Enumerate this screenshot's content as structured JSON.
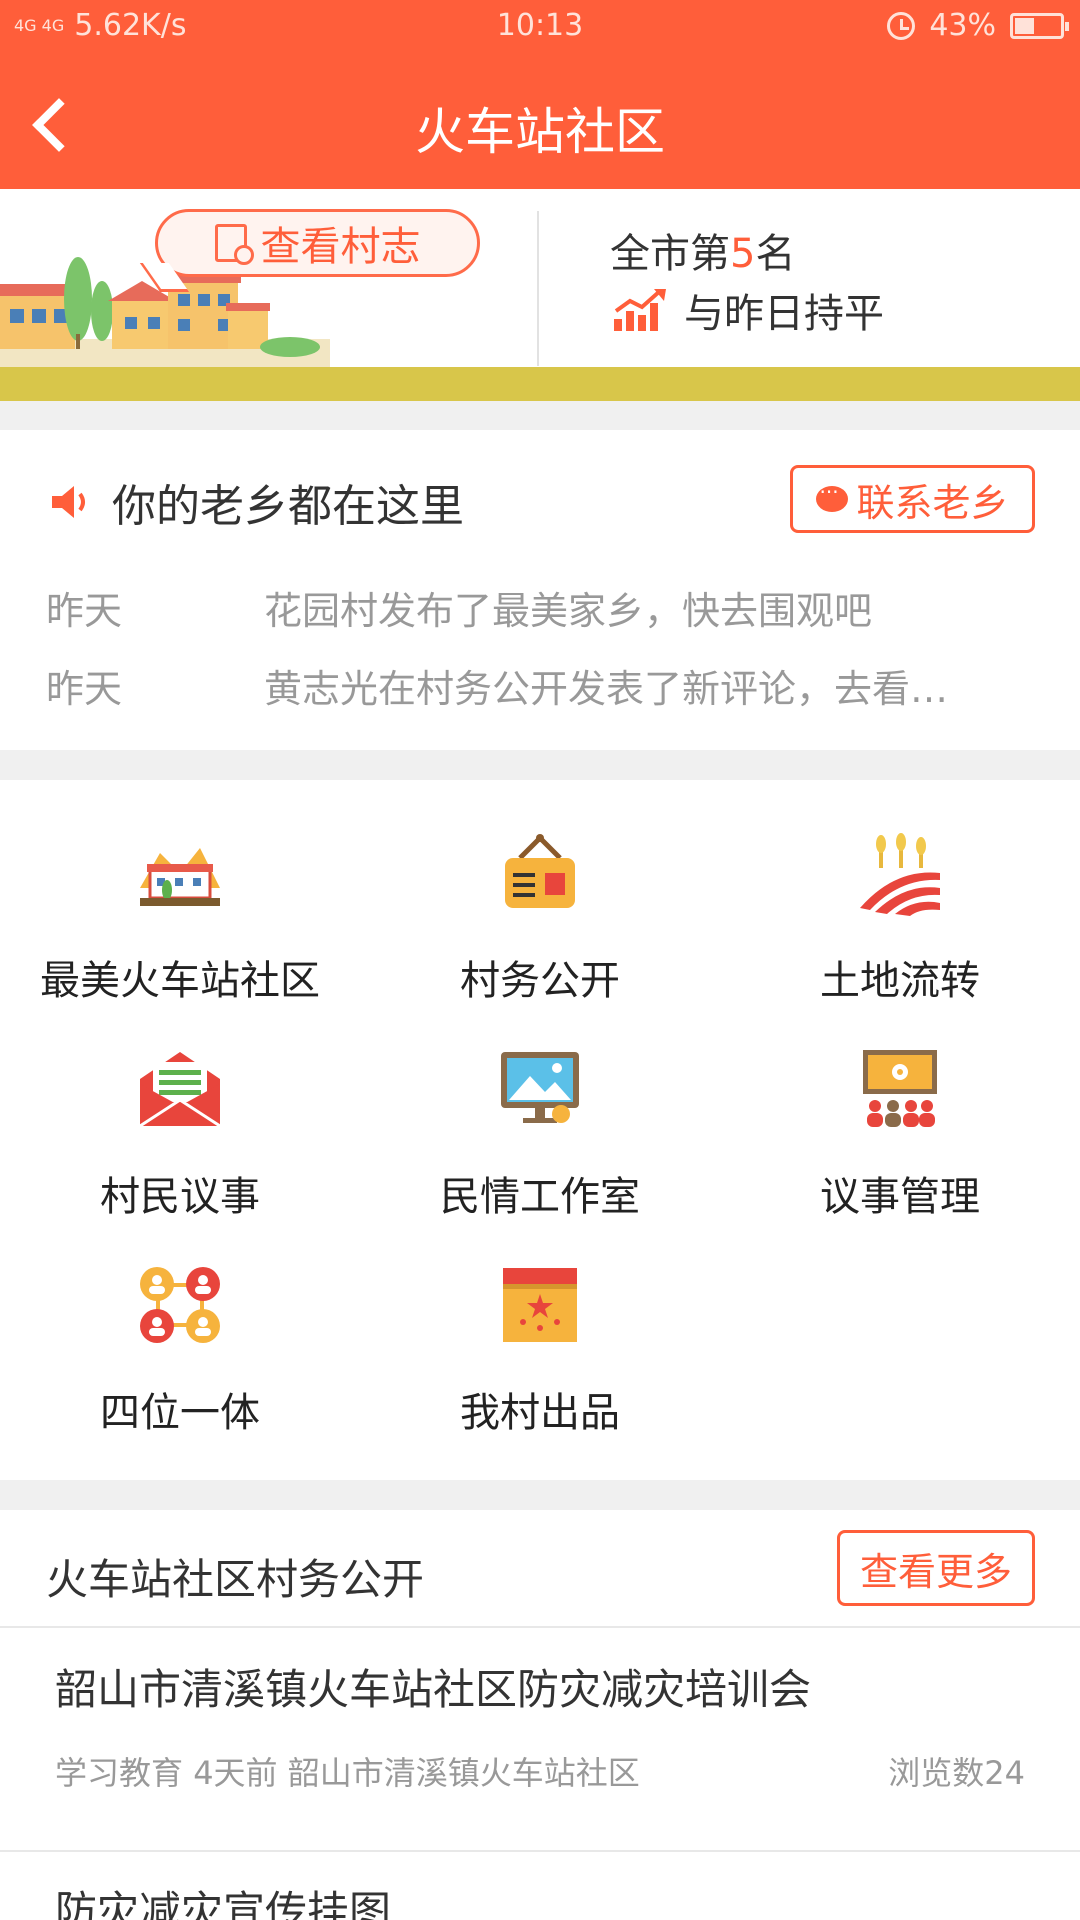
{
  "status": {
    "network": "4G 4G",
    "speed": "5.62K/s",
    "time": "10:13",
    "battery": "43%",
    "battery_fraction": 0.43
  },
  "nav": {
    "title": "火车站社区"
  },
  "banner": {
    "bubble_label": "查看村志",
    "rank_prefix": "全市第",
    "rank_number": "5",
    "rank_suffix": "名",
    "trend_text": "与昨日持平"
  },
  "hometown": {
    "heading": "你的老乡都在这里",
    "contact_label": "联系老乡",
    "news": [
      {
        "date": "昨天",
        "text": "花园村发布了最美家乡，快去围观吧"
      },
      {
        "date": "昨天",
        "text": "黄志光在村务公开发表了新评论，去看…"
      }
    ]
  },
  "grid": [
    {
      "label": "最美火车站社区",
      "icon": "village-scene-icon"
    },
    {
      "label": "村务公开",
      "icon": "bulletin-board-icon"
    },
    {
      "label": "土地流转",
      "icon": "wheat-field-icon"
    },
    {
      "label": "村民议事",
      "icon": "envelope-icon"
    },
    {
      "label": "民情工作室",
      "icon": "monitor-touch-icon"
    },
    {
      "label": "议事管理",
      "icon": "meeting-screen-icon"
    },
    {
      "label": "四位一体",
      "icon": "four-people-icon"
    },
    {
      "label": "我村出品",
      "icon": "product-box-icon"
    }
  ],
  "affairs": {
    "title": "火车站社区村务公开",
    "more_label": "查看更多",
    "articles": [
      {
        "title": "韶山市清溪镇火车站社区防灾减灾培训会",
        "category": "学习教育",
        "time": "4天前",
        "org": "韶山市清溪镇火车站社区",
        "views": "浏览数24"
      },
      {
        "title": "防灾减灾宣传挂图"
      }
    ]
  },
  "colors": {
    "accent": "#ff5e3a",
    "ground": "#d8c64a"
  }
}
